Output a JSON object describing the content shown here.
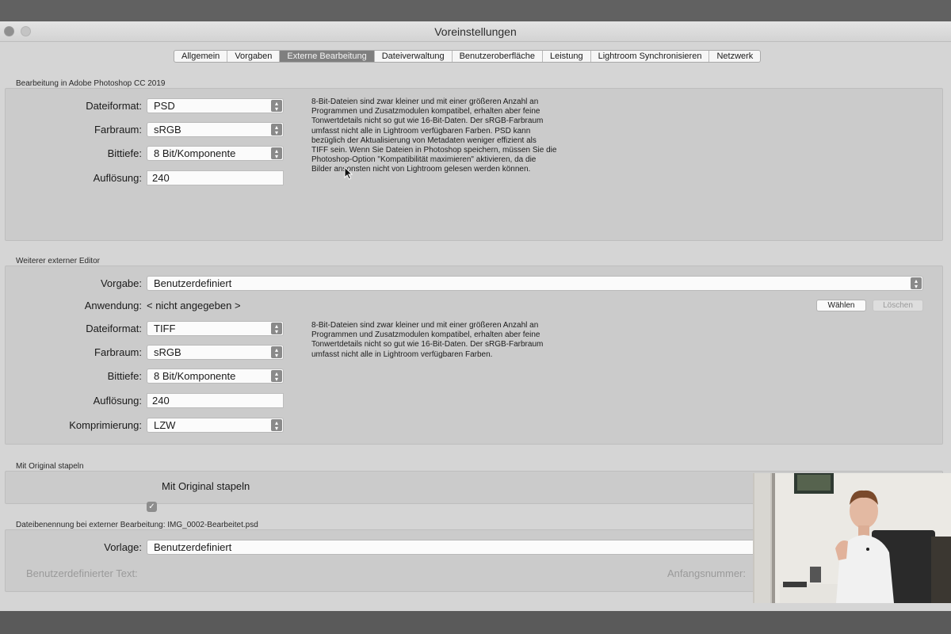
{
  "window": {
    "title": "Voreinstellungen"
  },
  "tabs": [
    {
      "label": "Allgemein",
      "active": false
    },
    {
      "label": "Vorgaben",
      "active": false
    },
    {
      "label": "Externe Bearbeitung",
      "active": true
    },
    {
      "label": "Dateiverwaltung",
      "active": false
    },
    {
      "label": "Benutzeroberfläche",
      "active": false
    },
    {
      "label": "Leistung",
      "active": false
    },
    {
      "label": "Lightroom Synchronisieren",
      "active": false
    },
    {
      "label": "Netzwerk",
      "active": false
    }
  ],
  "photoshop": {
    "title": "Bearbeitung in Adobe Photoshop CC 2019",
    "dateiformat_label": "Dateiformat:",
    "dateiformat": "PSD",
    "farbraum_label": "Farbraum:",
    "farbraum": "sRGB",
    "bittiefe_label": "Bittiefe:",
    "bittiefe": "8 Bit/Komponente",
    "aufloesung_label": "Auflösung:",
    "aufloesung": "240",
    "description_lines": [
      "8-Bit-Dateien sind zwar kleiner und mit einer größeren Anzahl an",
      "Programmen und Zusatzmodulen kompatibel, erhalten aber feine",
      "Tonwertdetails nicht so gut wie 16-Bit-Daten. Der sRGB-Farbraum",
      "umfasst nicht alle in Lightroom verfügbaren Farben. PSD kann",
      "bezüglich der Aktualisierung von Metadaten weniger effizient als",
      "TIFF sein. Wenn Sie Dateien in Photoshop speichern, müssen Sie die",
      "Photoshop-Option \"Kompatibilität maximieren\" aktivieren, da die",
      "Bilder ansonsten nicht von Lightroom gelesen werden können."
    ]
  },
  "external": {
    "title": "Weiterer externer Editor",
    "vorgabe_label": "Vorgabe:",
    "vorgabe": "Benutzerdefiniert",
    "anwendung_label": "Anwendung:",
    "anwendung": "< nicht angegeben >",
    "waehlen_label": "Wählen",
    "loeschen_label": "Löschen",
    "dateiformat_label": "Dateiformat:",
    "dateiformat": "TIFF",
    "farbraum_label": "Farbraum:",
    "farbraum": "sRGB",
    "bittiefe_label": "Bittiefe:",
    "bittiefe": "8 Bit/Komponente",
    "aufloesung_label": "Auflösung:",
    "aufloesung": "240",
    "komprimierung_label": "Komprimierung:",
    "komprimierung": "LZW",
    "description_lines": [
      "8-Bit-Dateien sind zwar kleiner und mit einer größeren Anzahl an",
      "Programmen und Zusatzmodulen kompatibel, erhalten aber feine",
      "Tonwertdetails nicht so gut wie 16-Bit-Daten. Der sRGB-Farbraum",
      "umfasst nicht alle in Lightroom verfügbaren Farben."
    ]
  },
  "stack": {
    "title": "Mit Original stapeln",
    "checkbox_label": "Mit Original stapeln",
    "checked": true
  },
  "naming": {
    "title": "Dateibenennung bei externer Bearbeitung: IMG_0002-Bearbeitet.psd",
    "vorlage_label": "Vorlage:",
    "vorlage": "Benutzerdefiniert",
    "custom_text_label": "Benutzerdefinierter Text:",
    "start_number_label": "Anfangsnummer:"
  },
  "colors": {
    "active_tab": "#7f7f7f",
    "panel": "#cbcbcb",
    "window": "#d5d5d5"
  }
}
